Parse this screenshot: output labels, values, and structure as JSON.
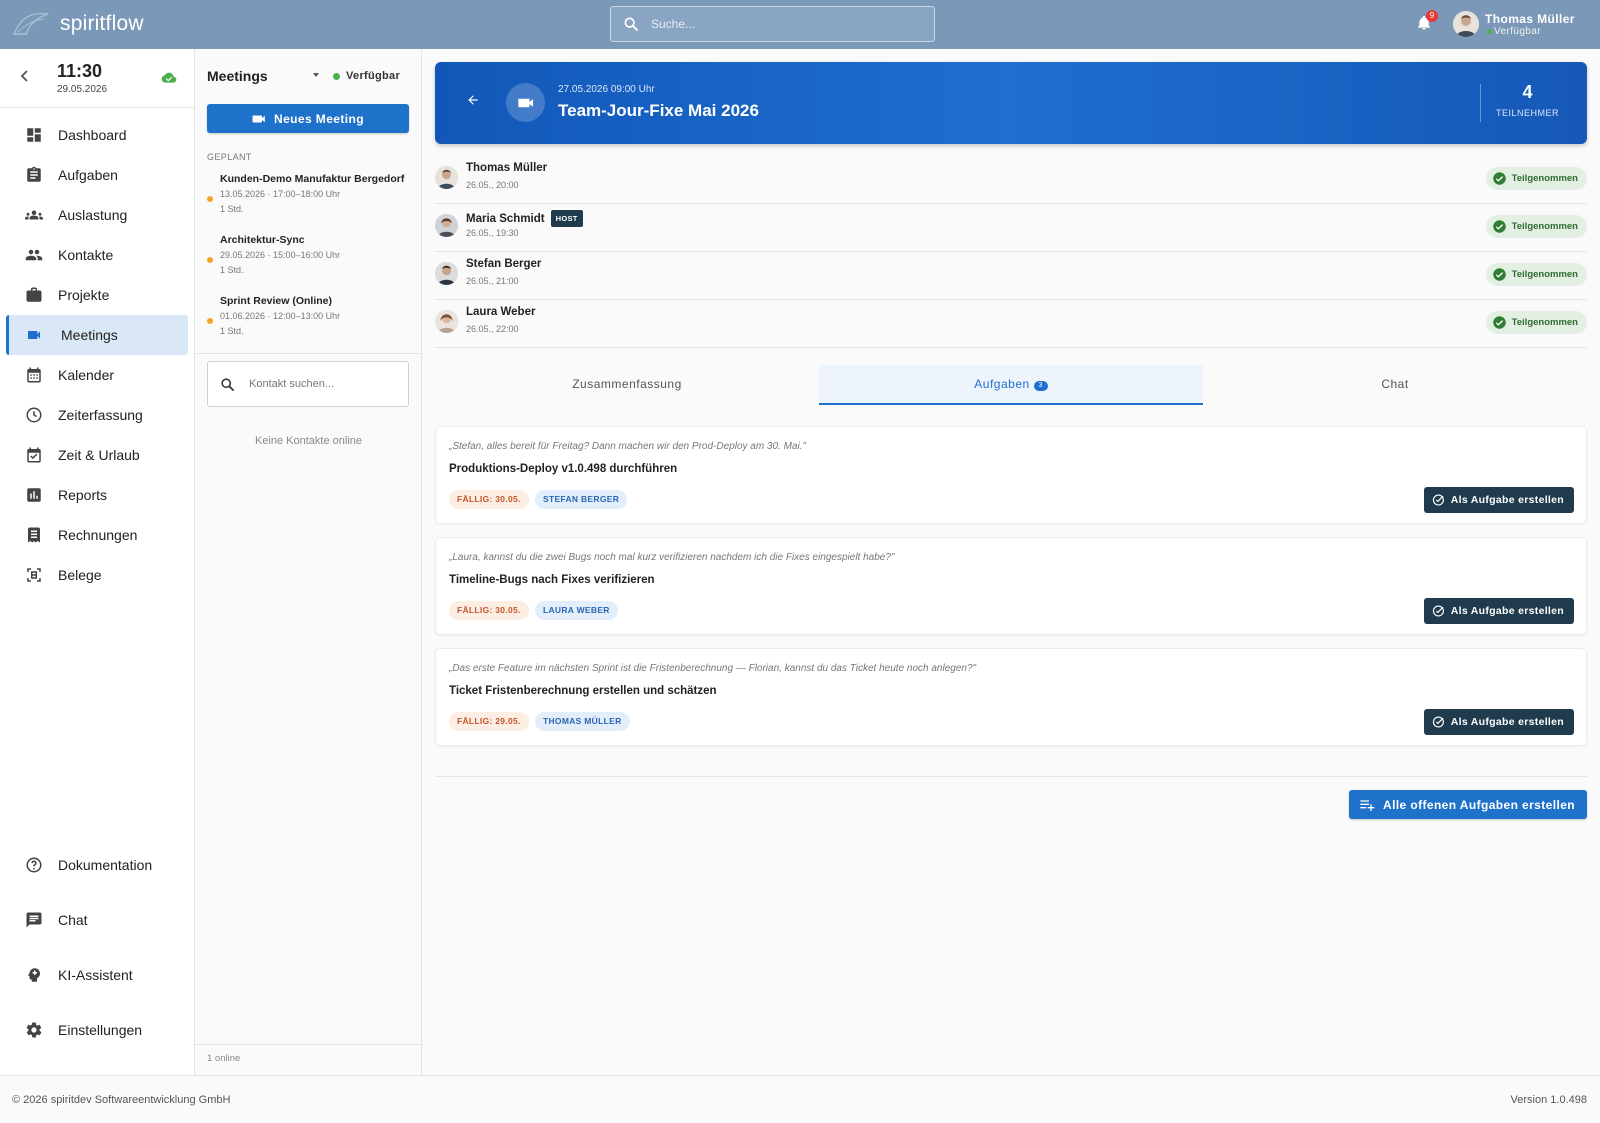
{
  "app": {
    "name": "spiritflow"
  },
  "topbar": {
    "search_placeholder": "Suche...",
    "notification_count": "9",
    "user_name": "Thomas Müller",
    "user_status": "Verfügbar"
  },
  "sidebar": {
    "time": "11:30",
    "date": "29.05.2026",
    "items": [
      {
        "label": "Dashboard",
        "icon": "dashboard-icon"
      },
      {
        "label": "Aufgaben",
        "icon": "clipboard-icon"
      },
      {
        "label": "Auslastung",
        "icon": "group-icon"
      },
      {
        "label": "Kontakte",
        "icon": "people-icon"
      },
      {
        "label": "Projekte",
        "icon": "briefcase-icon"
      },
      {
        "label": "Meetings",
        "icon": "videocam-icon",
        "active": true
      },
      {
        "label": "Kalender",
        "icon": "calendar-icon"
      },
      {
        "label": "Zeiterfassung",
        "icon": "clock-icon"
      },
      {
        "label": "Zeit & Urlaub",
        "icon": "event-check-icon"
      },
      {
        "label": "Reports",
        "icon": "chart-icon"
      },
      {
        "label": "Rechnungen",
        "icon": "receipt-icon"
      },
      {
        "label": "Belege",
        "icon": "document-scan-icon"
      }
    ],
    "bottom_items": [
      {
        "label": "Dokumentation",
        "icon": "help-icon"
      },
      {
        "label": "Chat",
        "icon": "chat-icon"
      },
      {
        "label": "KI-Assistent",
        "icon": "ai-icon"
      },
      {
        "label": "Einstellungen",
        "icon": "gear-icon"
      }
    ]
  },
  "meetings_panel": {
    "title": "Meetings",
    "availability": "Verfügbar",
    "new_meeting_label": "Neues Meeting",
    "section_label": "GEPLANT",
    "items": [
      {
        "title": "Kunden-Demo Manufaktur Bergedorf",
        "time": "13.05.2026 · 17:00–18:00 Uhr",
        "duration": "1 Std."
      },
      {
        "title": "Architektur-Sync",
        "time": "29.05.2026 · 15:00–16:00 Uhr",
        "duration": "1 Std."
      },
      {
        "title": "Sprint Review (Online)",
        "time": "01.06.2026 · 12:00–13:00 Uhr",
        "duration": "1 Std."
      }
    ],
    "contact_search_placeholder": "Kontakt suchen...",
    "no_contacts": "Keine Kontakte online",
    "online_count": "1 online"
  },
  "meeting": {
    "datetime": "27.05.2026 09:00 Uhr",
    "title": "Team-Jour-Fixe Mai 2026",
    "participant_count": "4",
    "participant_label": "TEILNEHMER",
    "participants": [
      {
        "name": "Thomas Müller",
        "time": "26.05., 20:00",
        "status": "Teilgenommen",
        "host": ""
      },
      {
        "name": "Maria Schmidt",
        "time": "26.05., 19:30",
        "status": "Teilgenommen",
        "host": "HOST"
      },
      {
        "name": "Stefan Berger",
        "time": "26.05., 21:00",
        "status": "Teilgenommen",
        "host": ""
      },
      {
        "name": "Laura Weber",
        "time": "26.05., 22:00",
        "status": "Teilgenommen",
        "host": ""
      }
    ]
  },
  "tabs": [
    {
      "label": "Zusammenfassung",
      "badge": ""
    },
    {
      "label": "Aufgaben",
      "badge": "3",
      "active": true
    },
    {
      "label": "Chat",
      "badge": ""
    }
  ],
  "tasks": [
    {
      "quote": "„Stefan, alles bereit für Freitag? Dann machen wir den Prod-Deploy am 30. Mai.\"",
      "title": "Produktions-Deploy v1.0.498 durchführen",
      "due": "FÄLLIG: 30.05.",
      "assignee": "STEFAN BERGER",
      "button": "Als Aufgabe erstellen"
    },
    {
      "quote": "„Laura, kannst du die zwei Bugs noch mal kurz verifizieren nachdem ich die Fixes eingespielt habe?\"",
      "title": "Timeline-Bugs nach Fixes verifizieren",
      "due": "FÄLLIG: 30.05.",
      "assignee": "LAURA WEBER",
      "button": "Als Aufgabe erstellen"
    },
    {
      "quote": "„Das erste Feature im nächsten Sprint ist die Fristenberechnung — Florian, kannst du das Ticket heute noch anlegen?\"",
      "title": "Ticket Fristenberechnung erstellen und schätzen",
      "due": "FÄLLIG: 29.05.",
      "assignee": "THOMAS MÜLLER",
      "button": "Als Aufgabe erstellen"
    }
  ],
  "all_tasks_button": "Alle offenen Aufgaben erstellen",
  "footer": {
    "copyright": "© 2026 spiritdev Softwareentwicklung GmbH",
    "version": "Version 1.0.498"
  },
  "colors": {
    "topbar": "#7b98b9",
    "primary": "#1e72c9",
    "dark_button": "#1f3b4d",
    "status_green": "#4caf50"
  }
}
